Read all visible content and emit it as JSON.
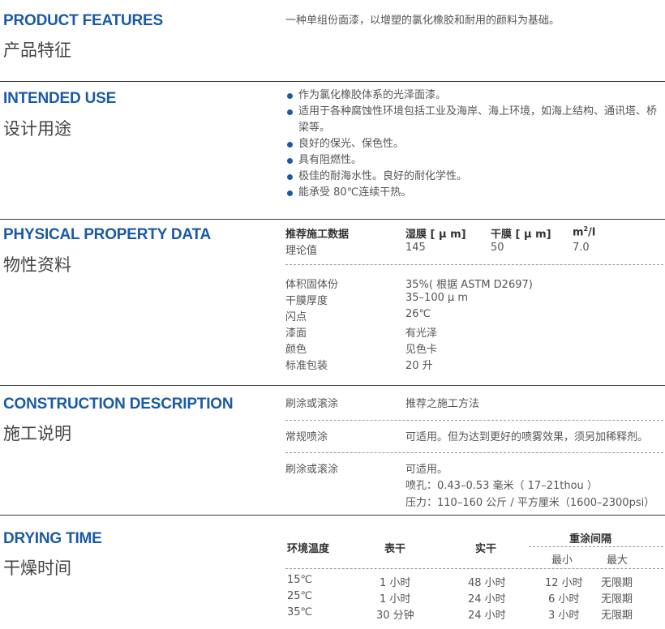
{
  "features": {
    "title_en": "PRODUCT FEATURES",
    "title_cn": "产品特征",
    "text": "一种单组份面漆，以增塑的氯化橡胶和耐用的颜料为基础。"
  },
  "intended_use": {
    "title_en": "INTENDED USE",
    "title_cn": "设计用途",
    "items": [
      "作为氯化橡胶体系的光泽面漆。",
      "适用于各种腐蚀性环境包括工业及海岸、海上环境，如海上结构、通讯塔、桥梁等。",
      "良好的保光、保色性。",
      "具有阻燃性。",
      "极佳的耐海水性。良好的耐化学性。",
      "能承受 80℃连续干热。"
    ],
    "bullet_color": "#1a5aa6"
  },
  "physical": {
    "title_en": "PHYSICAL PROPERTY DATA",
    "title_cn": "物性资料",
    "header": {
      "c1": "推荐施工数据",
      "c2": "湿膜 [ μ m]",
      "c3": "干膜 [ μ m]",
      "c4_base": "m",
      "c4_sup": "2",
      "c4_tail": "/l"
    },
    "row": {
      "c1": "理论值",
      "c2": "145",
      "c3": "50",
      "c4": "7.0"
    },
    "props": [
      {
        "label": "体积固体份",
        "value": "35%( 根据 ASTM D2697)"
      },
      {
        "label": "干膜厚度",
        "value": "35–100 μ m"
      },
      {
        "label": "闪点",
        "value": "26℃"
      },
      {
        "label": "漆面",
        "value": "有光泽"
      },
      {
        "label": "颜色",
        "value": "见色卡"
      },
      {
        "label": "标准包装",
        "value": "20 升"
      }
    ]
  },
  "construction": {
    "title_en": "CONSTRUCTION DESCRIPTION",
    "title_cn": "施工说明",
    "row1": {
      "method": "刷涂或滚涂",
      "desc": "推荐之施工方法"
    },
    "row2": {
      "method": "常规喷涂",
      "desc": "可适用。但为达到更好的喷雾效果，须另加稀释剂。"
    },
    "row3": {
      "method": "刷涂或滚涂",
      "desc1": "可适用。",
      "desc2": "喷孔：0.43–0.53 毫米（ 17–21thou ）",
      "desc3": "压力：110–160 公斤 / 平方厘米（1600–2300psi）"
    }
  },
  "drying": {
    "title_en": "DRYING TIME",
    "title_cn": "干燥时间",
    "headers": {
      "temp": "环境温度",
      "surface": "表干",
      "hard": "实干",
      "recoat": "重涂间隔",
      "min": "最小",
      "max": "最大"
    },
    "rows": [
      {
        "temp": "15℃",
        "surface": "1 小时",
        "hard": "48 小时",
        "min": "12 小时",
        "max": "无限期"
      },
      {
        "temp": "25℃",
        "surface": "1 小时",
        "hard": "24 小时",
        "min": "6 小时",
        "max": "无限期"
      },
      {
        "temp": "35℃",
        "surface": "30 分钟",
        "hard": "24 小时",
        "min": "3 小时",
        "max": "无限期"
      }
    ]
  },
  "accent_color": "#1a5aa6"
}
